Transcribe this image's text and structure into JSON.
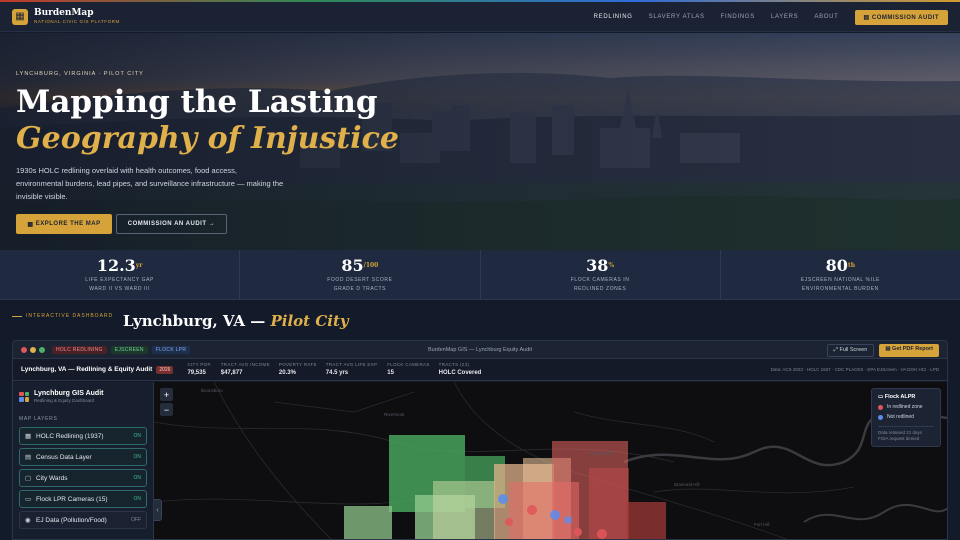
{
  "nav": {
    "brand": "BurdenMap",
    "tagline": "NATIONAL CIVIC GIS PLATFORM",
    "links": [
      "REDLINING",
      "SLAVERY ATLAS",
      "FINDINGS",
      "LAYERS",
      "ABOUT"
    ],
    "cta": "COMMISSION AUDIT"
  },
  "hero": {
    "eyebrow": "LYNCHBURG, VIRGINIA · PILOT CITY",
    "title_line1": "Mapping the Lasting",
    "title_line2": "Geography of Injustice",
    "lede": "1930s HOLC redlining overlaid with health outcomes, food access, environmental burdens, lead pipes, and surveillance infrastructure — making the invisible visible.",
    "primary_button": "EXPLORE THE MAP",
    "secondary_button": "COMMISSION AN AUDIT →"
  },
  "stats": [
    {
      "value": "12.3",
      "unit": "yr",
      "label1": "LIFE EXPECTANCY GAP",
      "label2": "WARD II VS WARD III"
    },
    {
      "value": "85",
      "unit": "/100",
      "label1": "FOOD DESERT SCORE",
      "label2": "GRADE D TRACTS"
    },
    {
      "value": "38",
      "unit": "%",
      "label1": "FLOCK CAMERAS IN",
      "label2": "REDLINED ZONES"
    },
    {
      "value": "80",
      "unit": "th",
      "label1": "EJSCREEN NATIONAL %ILE",
      "label2": "ENVIRONMENTAL BURDEN"
    }
  ],
  "section": {
    "kicker": "INTERACTIVE DASHBOARD",
    "title": "Lynchburg, VA —",
    "title_em": "Pilot City"
  },
  "window": {
    "tags": [
      "HOLC REDLINING",
      "EJSCREEN",
      "FLOCK LPR"
    ],
    "title": "BurdenMap GIS — Lynchburg Equity Audit",
    "fullscreen": "Full Screen",
    "pdf": "Get PDF Report"
  },
  "infobar": {
    "title": "Lynchburg, VA — Redlining & Equity Audit",
    "year": "2026",
    "metrics": [
      {
        "label": "CITY POP.",
        "value": "79,535"
      },
      {
        "label": "TRACT AVG INCOME",
        "value": "$47,877"
      },
      {
        "label": "POVERTY RATE",
        "value": "20.3%"
      },
      {
        "label": "TRACT AVG LIFE EXP.",
        "value": "74.5 yrs"
      },
      {
        "label": "FLOCK CAMERAS",
        "value": "15"
      },
      {
        "label": "TRACTS (23)",
        "value": "HOLC Covered"
      }
    ],
    "sources": "Data: ACS 2023 · HOLC 1937 · CDC PLACES · EPA EJScreen · VA DOH HCI · LPD"
  },
  "sidebar": {
    "app_title": "Lynchburg GIS Audit",
    "app_subtitle": "Redlining & Equity Dashboard",
    "section_label": "MAP LAYERS",
    "layers": [
      {
        "icon": "▦",
        "name": "HOLC Redlining (1937)",
        "state": "ON"
      },
      {
        "icon": "▤",
        "name": "Census Data Layer",
        "state": "ON"
      },
      {
        "icon": "▢",
        "name": "City Wards",
        "state": "ON"
      },
      {
        "icon": "▭",
        "name": "Flock LPR Cameras (15)",
        "state": "ON"
      },
      {
        "icon": "◉",
        "name": "EJ Data (Pollution/Food)",
        "state": "OFF"
      }
    ]
  },
  "map": {
    "place_labels": [
      "Boonsboro",
      "Rivermont",
      "Daniels Hill",
      "Diamond Hill",
      "Fort Hill"
    ],
    "legend": {
      "title": "Flock ALPR",
      "items": [
        {
          "label": "In redlined zone",
          "color": "#e0575a"
        },
        {
          "label": "Not redlined",
          "color": "#5b8def"
        }
      ],
      "note_line1": "Data retained 21 days",
      "note_line2": "FOIA request denied"
    },
    "zoom_in": "+",
    "zoom_out": "−"
  },
  "colors": {
    "accent": "#d6a23a",
    "grade_a": "#4caf63",
    "grade_b": "#8fc78a",
    "grade_c": "#e0b28a",
    "grade_d": "#d9605d",
    "camera": "#5b8def"
  }
}
